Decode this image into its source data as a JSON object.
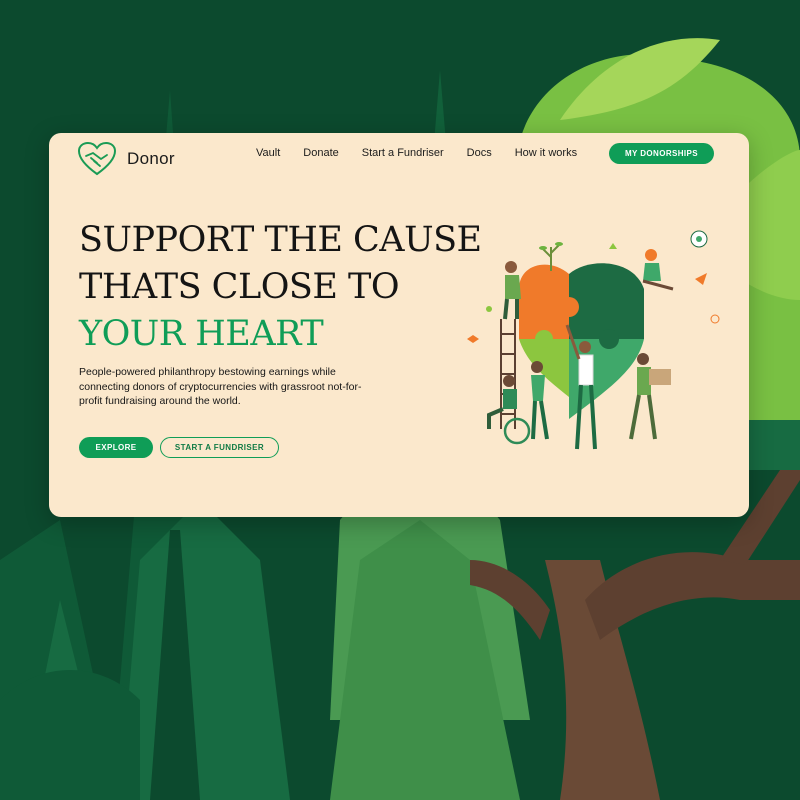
{
  "brand": {
    "name": "Donor",
    "icon": "heart-handshake-icon"
  },
  "nav": {
    "links": [
      "Vault",
      "Donate",
      "Start a Fundriser",
      "Docs",
      "How it works"
    ],
    "cta": "MY DONORSHIPS"
  },
  "hero": {
    "headline_line1": "SUPPORT THE CAUSE",
    "headline_line2": "THATS CLOSE TO",
    "headline_line3": "YOUR HEART",
    "description": "People-powered philanthropy bestowing earnings while connecting donors of cryptocurrencies with grassroot not-for-profit fundraising around the world.",
    "primary_button": "EXPLORE",
    "secondary_button": "START A FUNDRISER"
  },
  "colors": {
    "accent": "#0f9d57",
    "card_background": "#fbe8cc",
    "forest_dark": "#0c4a2e",
    "leaf_light": "#7ac142"
  }
}
